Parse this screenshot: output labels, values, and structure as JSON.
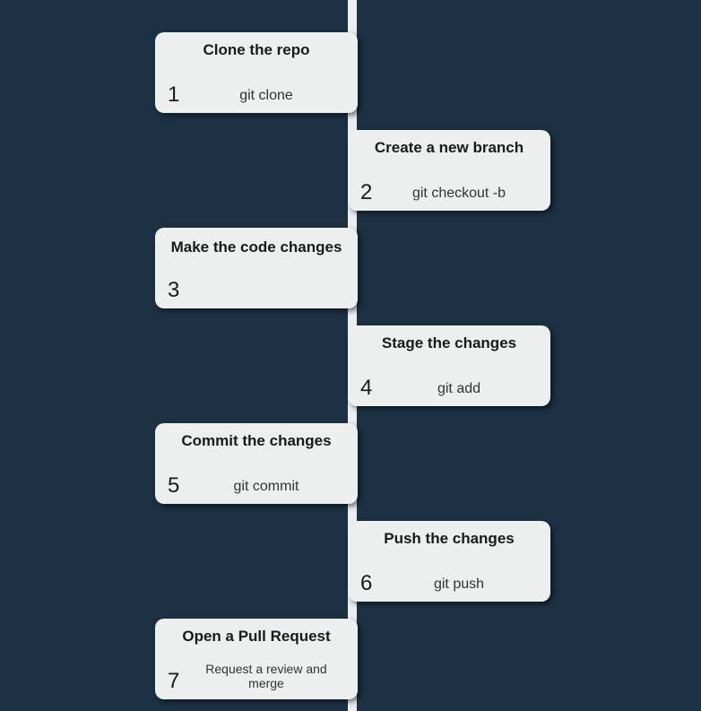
{
  "steps": [
    {
      "num": "1",
      "title": "Clone the repo",
      "cmd": "git  clone"
    },
    {
      "num": "2",
      "title": "Create a new branch",
      "cmd": "git checkout -b"
    },
    {
      "num": "3",
      "title": "Make the code changes",
      "cmd": ""
    },
    {
      "num": "4",
      "title": "Stage the changes",
      "cmd": "git add"
    },
    {
      "num": "5",
      "title": "Commit the changes",
      "cmd": "git commit"
    },
    {
      "num": "6",
      "title": "Push the changes",
      "cmd": "git push"
    },
    {
      "num": "7",
      "title": "Open a Pull Request",
      "cmd": "Request a review and merge"
    }
  ]
}
